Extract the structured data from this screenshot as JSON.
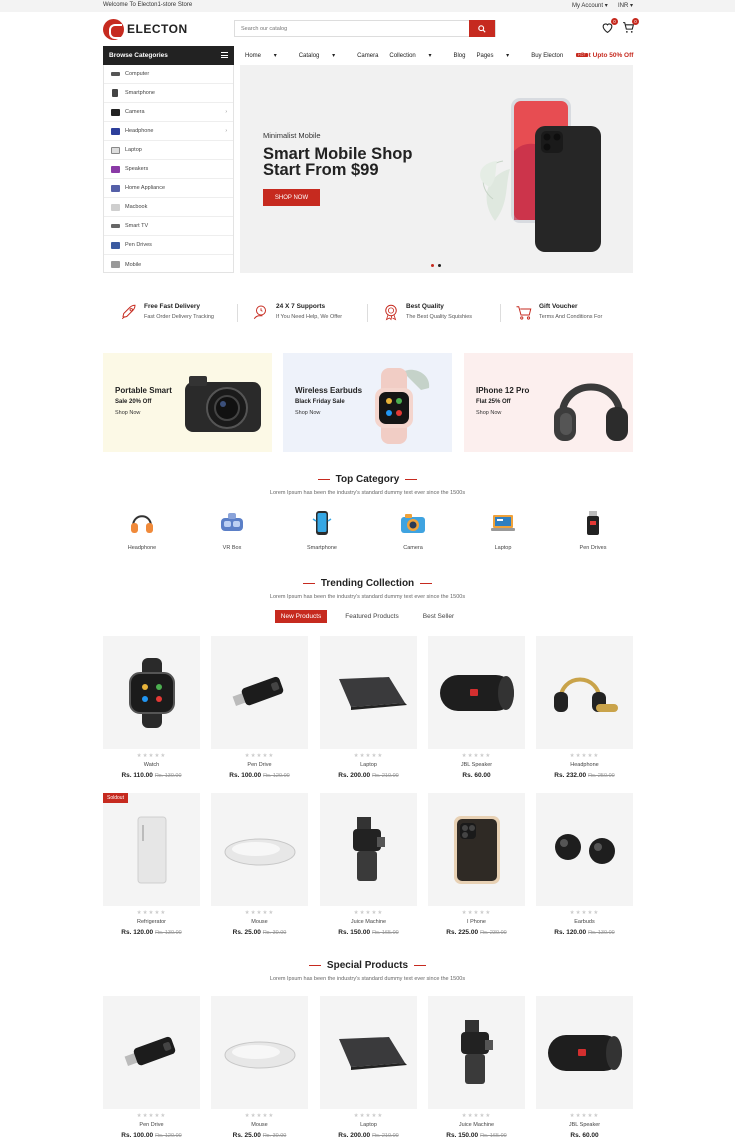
{
  "topbar": {
    "welcome": "Welcome To Electon1-store Store",
    "account": "My Account",
    "currency": "INR"
  },
  "header": {
    "logo_text": "ELECTON",
    "search_placeholder": "Search our catalog",
    "wishlist_count": "0",
    "cart_count": "0"
  },
  "nav": {
    "browse_label": "Browse Categories",
    "items": [
      "Home",
      "Catalog",
      "Camera",
      "Collection",
      "Blog",
      "Pages",
      "Buy Electon"
    ],
    "hot_badge": "HOT",
    "promo": "Get Upto 50% Off"
  },
  "sidebar": {
    "items": [
      "Computer",
      "Smartphone",
      "Camera",
      "Headphone",
      "Laptop",
      "Speakers",
      "Home Appliance",
      "Macbook",
      "Smart TV",
      "Pen Drives",
      "Mobile"
    ]
  },
  "slider": {
    "subtitle": "Minimalist Mobile",
    "title_line1": "Smart Mobile Shop",
    "title_line2": "Start From $99",
    "button": "SHOP NOW"
  },
  "services": [
    {
      "title": "Free Fast Delivery",
      "desc": "Fast Order Delivery Tracking"
    },
    {
      "title": "24 X 7 Supports",
      "desc": "If You Need Help, We Offer"
    },
    {
      "title": "Best Quality",
      "desc": "The Best Quality Squishies"
    },
    {
      "title": "Gift Voucher",
      "desc": "Terms And Conditions For"
    }
  ],
  "banners": [
    {
      "title": "Portable Smart",
      "sub": "Sale 20% Off",
      "link": "Shop Now",
      "bg": "#fcf9e6"
    },
    {
      "title": "Wireless Earbuds",
      "sub": "Black Friday Sale",
      "link": "Shop Now",
      "bg": "#eef2fa"
    },
    {
      "title": "IPhone 12 Pro",
      "sub": "Flat 25% Off",
      "link": "Shop Now",
      "bg": "#fcefee"
    }
  ],
  "top_category": {
    "title": "Top Category",
    "desc": "Lorem Ipsum has been the industry's standard dummy text ever since the 1500s",
    "items": [
      "Headphone",
      "VR Box",
      "Smartphone",
      "Camera",
      "Laptop",
      "Pen Drives"
    ]
  },
  "trending": {
    "title": "Trending Collection",
    "desc": "Lorem Ipsum has been the industry's standard dummy text ever since the 1500s",
    "tabs": [
      "New Products",
      "Featured Products",
      "Best Seller"
    ],
    "soldout": "Soldout",
    "products": [
      {
        "name": "Watch",
        "price": "Rs. 110.00",
        "old": "Rs. 130.00"
      },
      {
        "name": "Pen Drive",
        "price": "Rs. 100.00",
        "old": "Rs. 120.00"
      },
      {
        "name": "Laptop",
        "price": "Rs. 200.00",
        "old": "Rs. 210.00"
      },
      {
        "name": "JBL Speaker",
        "price": "Rs. 60.00",
        "old": ""
      },
      {
        "name": "Headphone",
        "price": "Rs. 232.00",
        "old": "Rs. 250.00"
      },
      {
        "name": "Refrigerator",
        "price": "Rs. 120.00",
        "old": "Rs. 130.00"
      },
      {
        "name": "Mouse",
        "price": "Rs. 25.00",
        "old": "Rs. 30.00"
      },
      {
        "name": "Juice Machine",
        "price": "Rs. 150.00",
        "old": "Rs. 165.00"
      },
      {
        "name": "I Phone",
        "price": "Rs. 225.00",
        "old": "Rs. 230.00"
      },
      {
        "name": "Earbuds",
        "price": "Rs. 120.00",
        "old": "Rs. 130.00"
      }
    ]
  },
  "special": {
    "title": "Special Products",
    "desc": "Lorem Ipsum has been the industry's standard dummy text ever since the 1500s",
    "products": [
      {
        "name": "Pen Drive",
        "price": "Rs. 100.00",
        "old": "Rs. 120.00"
      },
      {
        "name": "Mouse",
        "price": "Rs. 25.00",
        "old": "Rs. 30.00"
      },
      {
        "name": "Laptop",
        "price": "Rs. 200.00",
        "old": "Rs. 210.00"
      },
      {
        "name": "Juice Machine",
        "price": "Rs. 150.00",
        "old": "Rs. 165.00"
      },
      {
        "name": "JBL Speaker",
        "price": "Rs. 60.00",
        "old": ""
      }
    ]
  },
  "colors": {
    "accent": "#c62a1f",
    "dark": "#222222"
  }
}
